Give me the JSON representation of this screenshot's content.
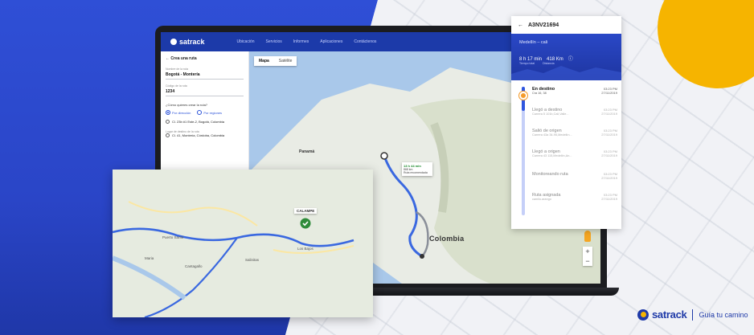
{
  "app": {
    "logo": "satrack",
    "nav": [
      "Ubicación",
      "Servicios",
      "Informes",
      "Aplicaciones",
      "Contáctenos"
    ]
  },
  "route_panel": {
    "title": "Crea una ruta",
    "name_label": "Nombre de la ruta",
    "name_value": "Bogotá - Montería",
    "code_label": "Código de la ruta",
    "code_value": "1234",
    "question": "¿Cómo quieres crear la ruta?",
    "option_address": "Por dirección",
    "option_regions": "Por regiones",
    "origin": "Cl. 23b #1 Este-2, Bogotá, Colombia",
    "destination_label": "Lugar de destino de la ruta",
    "destination": "Cl. 41, Montería, Córdoba, Colombia"
  },
  "map": {
    "tab_map": "Mapa",
    "tab_satellite": "Satélite",
    "labels": {
      "panama": "Panamá",
      "colombia": "Colombia"
    },
    "bubble_time": "13 h 44 min",
    "bubble_distance": "868 km",
    "bubble_note": "Ruta recomendada",
    "zoom_in": "+",
    "zoom_out": "−"
  },
  "tracking": {
    "plate": "A3NV21694",
    "route": "Medellín – cali",
    "time_value": "8 h 17 min",
    "distance_value": "418 Km",
    "time_caption": "Tiempo total",
    "distance_caption": "Distancia",
    "events": [
      {
        "title": "En destino",
        "sub": "Cra 16, 38",
        "time": "03:23 PM",
        "date": "27/11/2019"
      },
      {
        "title": "Llegó a destino",
        "sub": "Carrera 5 101b,Cali,Valle...",
        "time": "03:23 PM",
        "date": "27/11/2019"
      },
      {
        "title": "Salió de origen",
        "sub": "Carrera 43a 34-95,Medellín...",
        "time": "03:23 PM",
        "date": "27/11/2019"
      },
      {
        "title": "Llegó a origen",
        "sub": "Carrera 43 115,Medellín,An...",
        "time": "03:23 PM",
        "date": "27/11/2019"
      },
      {
        "title": "Monitoreando ruta",
        "sub": "",
        "time": "03:23 PM",
        "date": "27/11/2019"
      },
      {
        "title": "Ruta asignada",
        "sub": "camilo.arango",
        "time": "03:23 PM",
        "date": "27/11/2019"
      }
    ]
  },
  "overlay_map": {
    "callout": "CALAMPE",
    "labels": [
      "Puerto Santo",
      "Los Bajos",
      "Maria",
      "Cantagallo",
      "Salinitas"
    ]
  },
  "brand": {
    "name": "satrack",
    "tagline": "Guía tu camino"
  }
}
